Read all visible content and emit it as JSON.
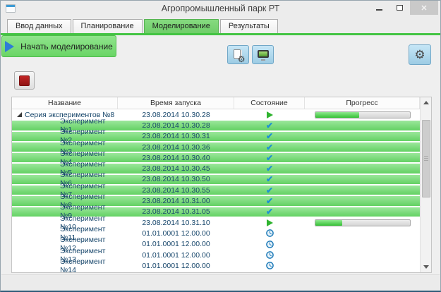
{
  "window": {
    "title": "Агропромышленный парк РТ"
  },
  "tabs": [
    {
      "label": "Ввод данных",
      "active": false
    },
    {
      "label": "Планирование",
      "active": false
    },
    {
      "label": "Моделирование",
      "active": true
    },
    {
      "label": "Результаты",
      "active": false
    }
  ],
  "toolbar": {
    "start_label": "Начать моделирование",
    "buttons": [
      "experiment-settings",
      "monitor-view",
      "start-modeling",
      "settings-gear"
    ]
  },
  "icons": {
    "close_glyph": "✕",
    "gear_glyph": "⚙",
    "check_glyph": "✔"
  },
  "colors": {
    "tab_active_green": "#6FCE69",
    "accent_underline": "#43C443",
    "row_highlight_green": "#63D163",
    "progress_fill": "#35C135",
    "check_blue": "#1C8FD4",
    "play_green": "#2FB32F",
    "stop_red": "#8F1414",
    "toolbar_button_blue": "#9DCCE4"
  },
  "table": {
    "columns": [
      "Название",
      "Время запуска",
      "Состояние",
      "Прогресс"
    ],
    "rows": [
      {
        "name": "Серия экспериментов №8",
        "time": "23.08.2014 10.30.28",
        "state": "running",
        "progress": 47,
        "type": "series",
        "highlight": false
      },
      {
        "name": "Эксперимент №1",
        "time": "23.08.2014 10.30.28",
        "state": "done",
        "progress": null,
        "type": "experiment",
        "highlight": true
      },
      {
        "name": "Эксперимент №2",
        "time": "23.08.2014 10.30.31",
        "state": "done",
        "progress": null,
        "type": "experiment",
        "highlight": true
      },
      {
        "name": "Эксперимент №3",
        "time": "23.08.2014 10.30.36",
        "state": "done",
        "progress": null,
        "type": "experiment",
        "highlight": true
      },
      {
        "name": "Эксперимент №4",
        "time": "23.08.2014 10.30.40",
        "state": "done",
        "progress": null,
        "type": "experiment",
        "highlight": true
      },
      {
        "name": "Эксперимент №5",
        "time": "23.08.2014 10.30.45",
        "state": "done",
        "progress": null,
        "type": "experiment",
        "highlight": true
      },
      {
        "name": "Эксперимент №6",
        "time": "23.08.2014 10.30.50",
        "state": "done",
        "progress": null,
        "type": "experiment",
        "highlight": true
      },
      {
        "name": "Эксперимент №7",
        "time": "23.08.2014 10.30.55",
        "state": "done",
        "progress": null,
        "type": "experiment",
        "highlight": true
      },
      {
        "name": "Эксперимент №8",
        "time": "23.08.2014 10.31.00",
        "state": "done",
        "progress": null,
        "type": "experiment",
        "highlight": true
      },
      {
        "name": "Эксперимент №9",
        "time": "23.08.2014 10.31.05",
        "state": "done",
        "progress": null,
        "type": "experiment",
        "highlight": true
      },
      {
        "name": "Эксперимент №10",
        "time": "23.08.2014 10.31.10",
        "state": "running",
        "progress": 29,
        "type": "experiment",
        "highlight": false
      },
      {
        "name": "Эксперимент №11",
        "time": "01.01.0001 12.00.00",
        "state": "pending",
        "progress": null,
        "type": "experiment",
        "highlight": false
      },
      {
        "name": "Эксперимент №12",
        "time": "01.01.0001 12.00.00",
        "state": "pending",
        "progress": null,
        "type": "experiment",
        "highlight": false
      },
      {
        "name": "Эксперимент №13",
        "time": "01.01.0001 12.00.00",
        "state": "pending",
        "progress": null,
        "type": "experiment",
        "highlight": false
      },
      {
        "name": "Эксперимент №14",
        "time": "01.01.0001 12.00.00",
        "state": "pending",
        "progress": null,
        "type": "experiment",
        "highlight": false
      },
      {
        "name": "",
        "time": "",
        "state": "pending",
        "progress": null,
        "type": "experiment",
        "highlight": false
      }
    ]
  }
}
